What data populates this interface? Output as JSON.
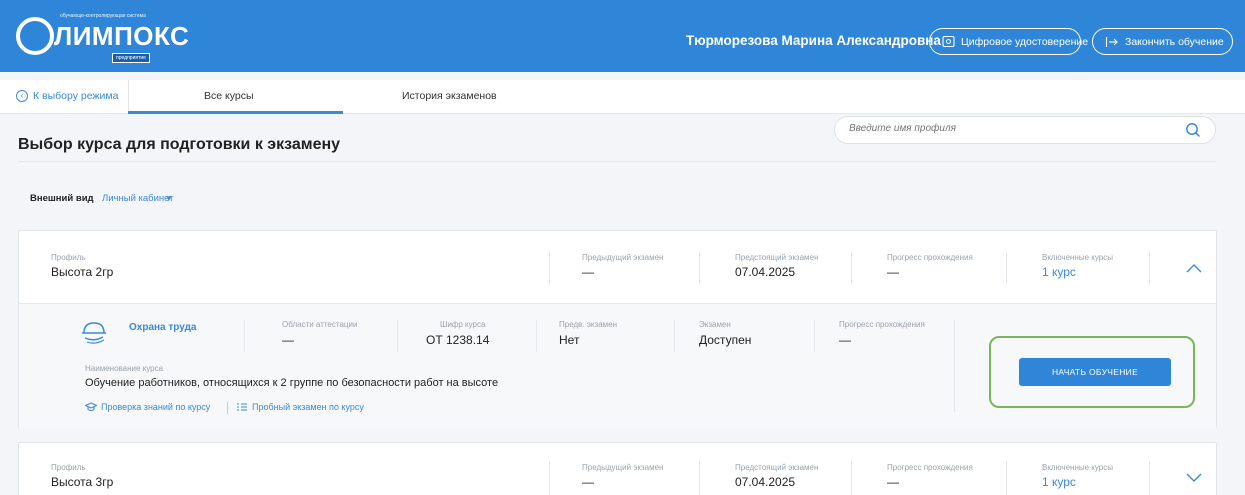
{
  "header": {
    "logo_tagline": "обучающе-контролирующая система",
    "logo_word": "ЛИМПОКС",
    "logo_sub": "предприятие",
    "user_name": "Тюрморезова Марина Александровна",
    "cert_button": "Цифровое удостоверение",
    "finish_button": "Закончить обучение"
  },
  "nav": {
    "back_label": "К выбору режима",
    "tabs": [
      {
        "label": "Все курсы",
        "active": true
      },
      {
        "label": "История экзаменов",
        "active": false
      }
    ]
  },
  "page": {
    "title": "Выбор курса для подготовки к экзамену",
    "search_placeholder": "Введите имя профиля",
    "view_label": "Внешний вид",
    "view_value": "Личный кабинет"
  },
  "profiles": [
    {
      "profile_label": "Профиль",
      "profile_name": "Высота 2гр",
      "prev_exam_label": "Предыдущий экзамен",
      "prev_exam": "—",
      "next_exam_label": "Предстоящий экзамен",
      "next_exam": "07.04.2025",
      "progress_label": "Прогресс прохождения",
      "progress": "—",
      "courses_label": "Включенные курсы",
      "courses": "1 курс",
      "expanded": true,
      "course": {
        "name": "Охрана труда",
        "areas_label": "Области аттестации",
        "areas": "—",
        "code_label": "Шифр курса",
        "code": "ОТ 1238.14",
        "prev_exam_label": "Предв. экзамен",
        "prev_exam": "Нет",
        "exam_label": "Экзамен",
        "exam": "Доступен",
        "progress_label": "Прогресс прохождения",
        "progress": "—",
        "full_name_label": "Наименование курса",
        "full_name": "Обучение работников, относящихся к 2 группе по безопасности работ на высоте",
        "link_check": "Проверка знаний по курсу",
        "link_trial": "Пробный экзамен по курсу",
        "start_button": "НАЧАТЬ ОБУЧЕНИЕ"
      }
    },
    {
      "profile_label": "Профиль",
      "profile_name": "Высота 3гр",
      "prev_exam_label": "Предыдущий экзамен",
      "prev_exam": "—",
      "next_exam_label": "Предстоящий экзамен",
      "next_exam": "07.04.2025",
      "progress_label": "Прогресс прохождения",
      "progress": "—",
      "courses_label": "Включенные курсы",
      "courses": "1 курс",
      "expanded": false
    }
  ],
  "colors": {
    "header_bg": "#2f86d8",
    "accent": "#3a8ad8",
    "highlight": "#7ab55c"
  }
}
